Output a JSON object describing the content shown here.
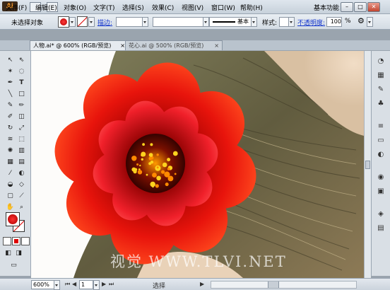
{
  "app": {
    "logo": "Ai",
    "workspace": "基本功能"
  },
  "menu": [
    "文件(F)",
    "编辑(E)",
    "对象(O)",
    "文字(T)",
    "选择(S)",
    "效果(C)",
    "视图(V)",
    "窗口(W)",
    "帮助(H)"
  ],
  "window_buttons": {
    "minimize": "–",
    "restore": "□",
    "close": "✕"
  },
  "control": {
    "selection": "未选择对象",
    "stroke_label": "描边:",
    "stroke_style": "基本",
    "style_label": "样式:",
    "opacity_label": "不透明度:",
    "opacity_value": "100",
    "opacity_unit": "%"
  },
  "tabs": [
    {
      "label": "人物.ai* @ 600% (RGB/预览)",
      "close": "×"
    },
    {
      "label": "花心.ai @ 500% (RGB/预览)",
      "close": "×"
    }
  ],
  "status": {
    "zoom": "600%",
    "page": "1",
    "tool": "选择"
  },
  "watermark": "视觉 WWW.TLVI.NET",
  "colors": {
    "fill": "#e00000",
    "accent": "#1133cc"
  }
}
